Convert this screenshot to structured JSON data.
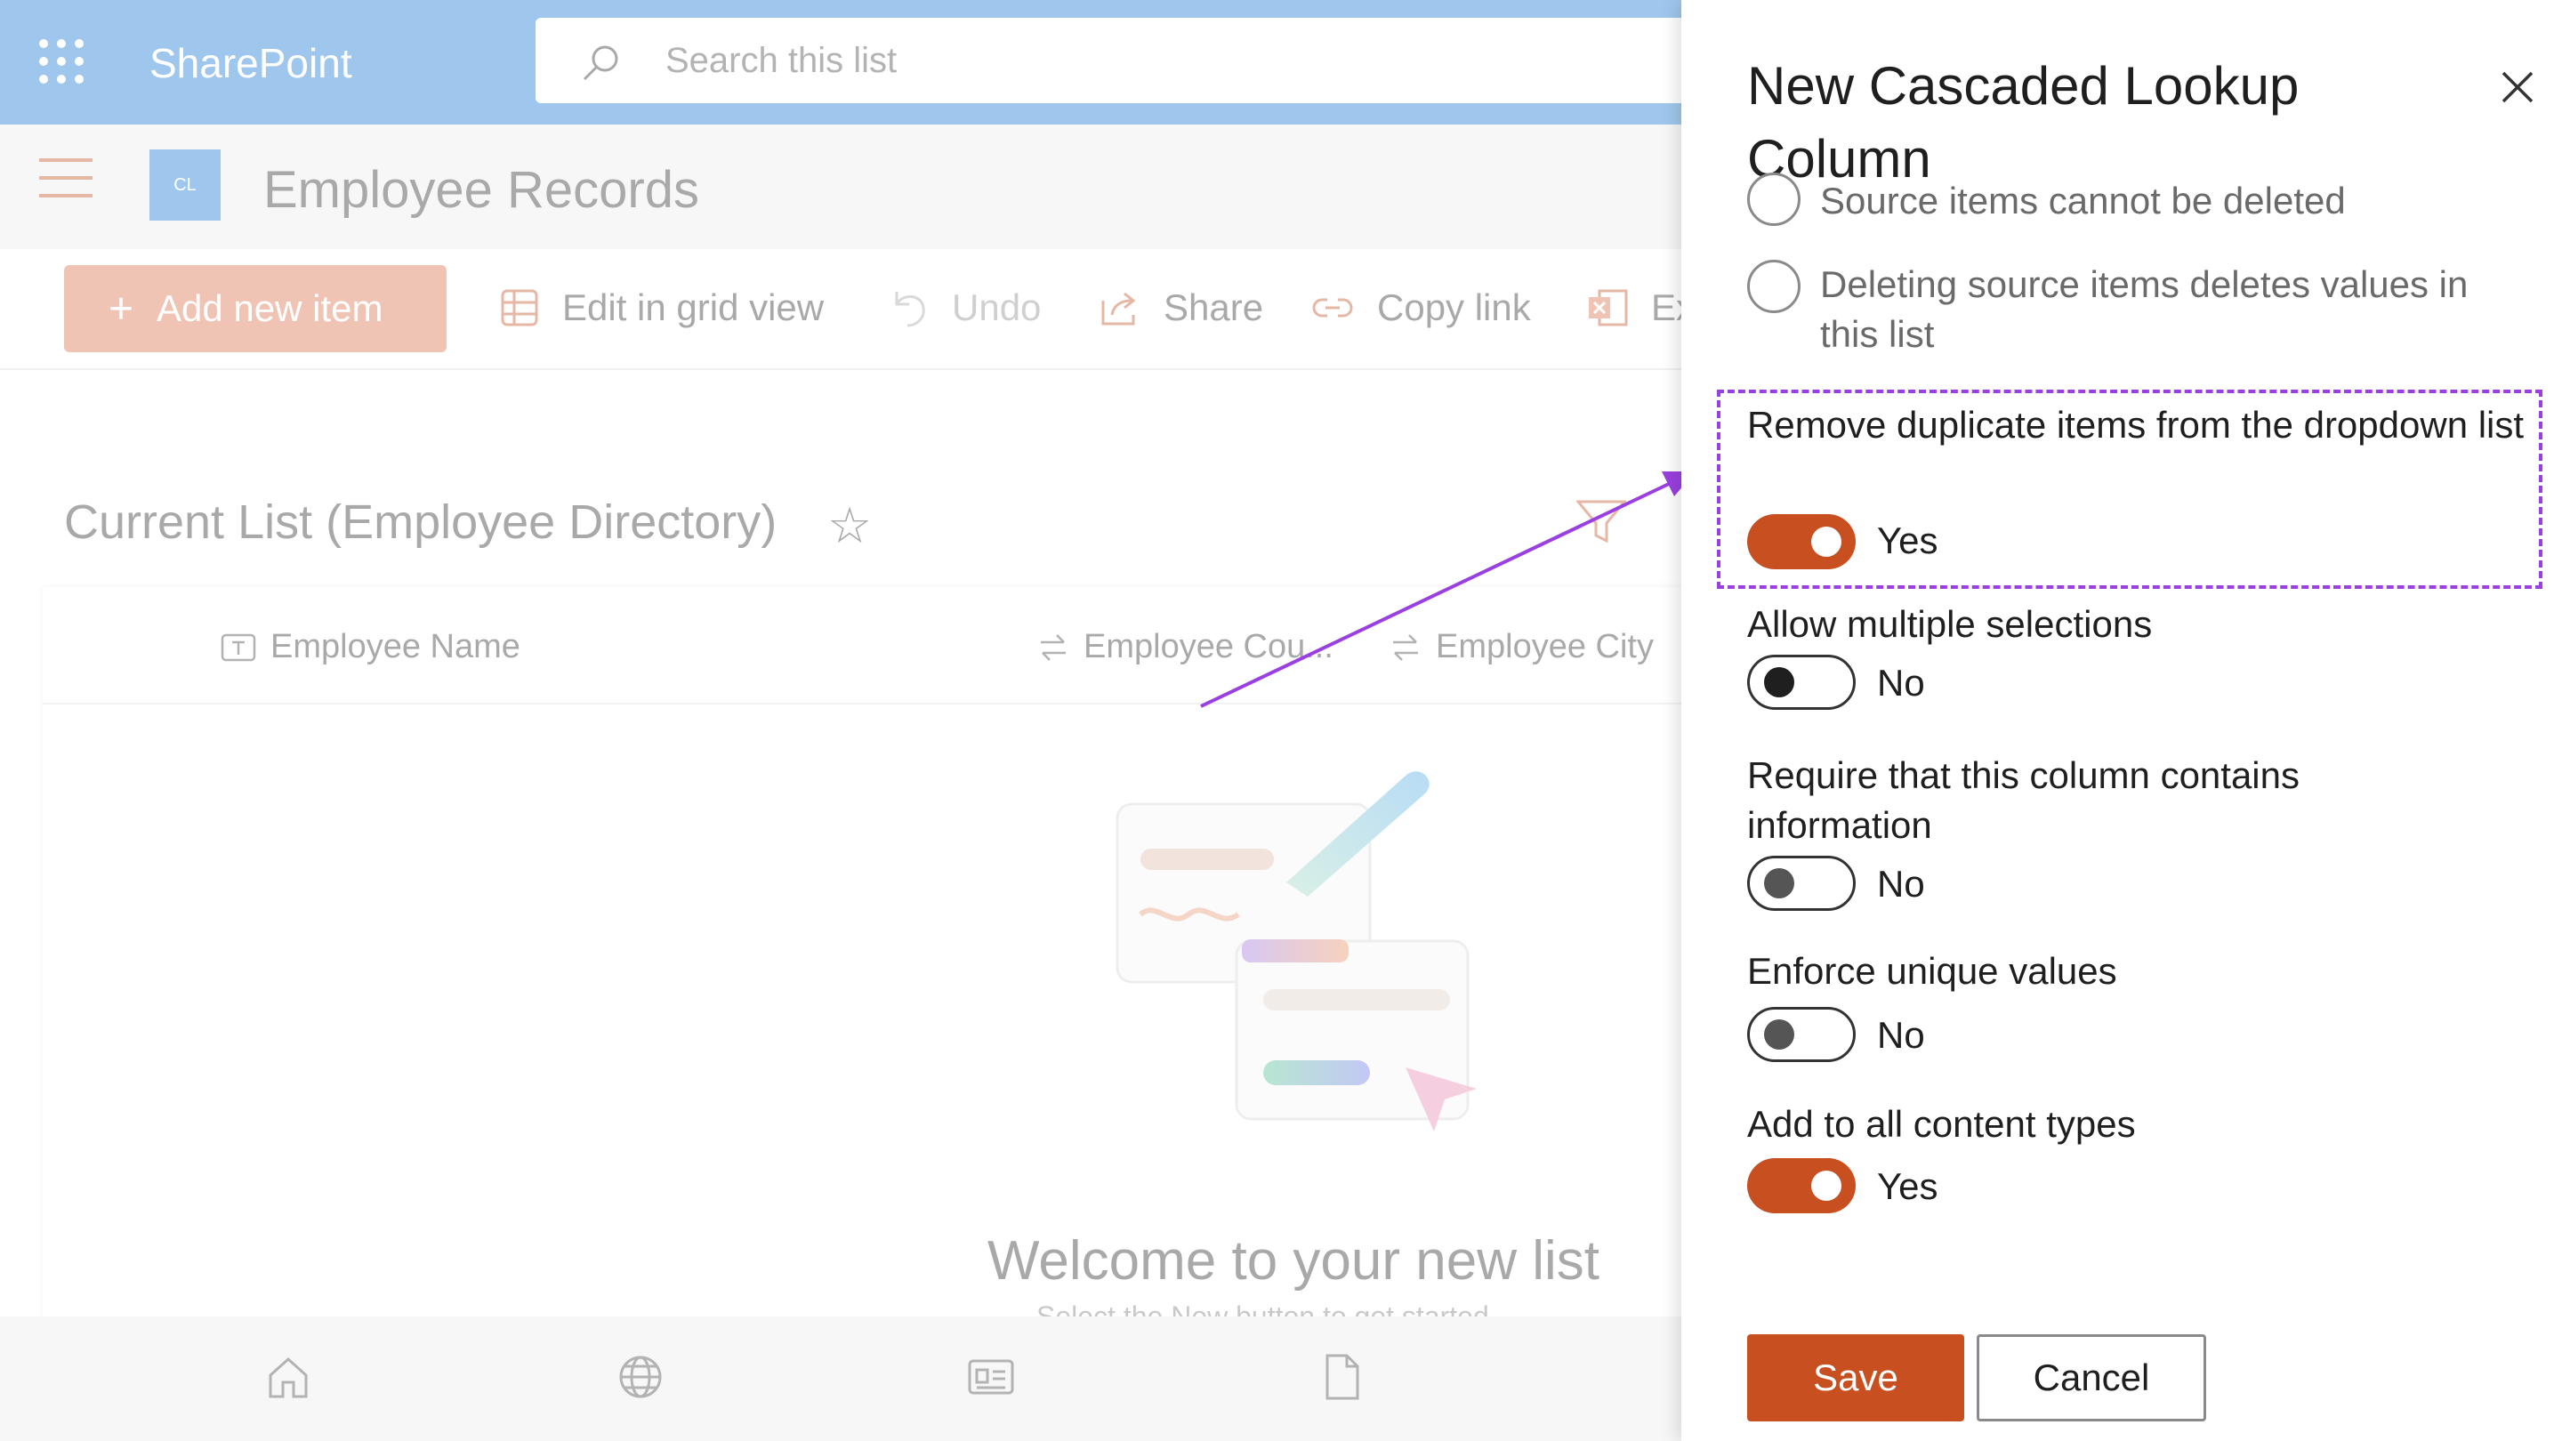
{
  "suitebar": {
    "app_name": "SharePoint",
    "search_placeholder": "Search this list",
    "waffle_icon": "waffle-icon"
  },
  "site": {
    "logo_text": "CL",
    "title": "Employee Records"
  },
  "commandbar": {
    "add_new_item": "Add new item",
    "edit_grid": "Edit in grid view",
    "undo": "Undo",
    "share": "Share",
    "copy_link": "Copy link",
    "export_partial": "Ex"
  },
  "list": {
    "title": "Current List (Employee Directory)",
    "columns": [
      "Employee Name",
      "Employee Cou...",
      "Employee City"
    ],
    "empty_title": "Welcome to your new list",
    "empty_subtitle": "Select the New button to get started."
  },
  "panel": {
    "title": "New Cascaded Lookup Column",
    "radio_options": [
      {
        "label": "Source items cannot be deleted",
        "selected": false
      },
      {
        "label": "Deleting source items deletes values in this list",
        "selected": false
      }
    ],
    "settings": [
      {
        "label": "Remove duplicate items from the dropdown list",
        "state": "Yes",
        "on": true,
        "highlighted": true
      },
      {
        "label": "Allow multiple selections",
        "state": "No",
        "on": false
      },
      {
        "label": "Require that this column contains information",
        "state": "No",
        "on": false
      },
      {
        "label": "Enforce unique values",
        "state": "No",
        "on": false
      },
      {
        "label": "Add to all content types",
        "state": "Yes",
        "on": true
      }
    ],
    "save_label": "Save",
    "cancel_label": "Cancel"
  },
  "colors": {
    "accent": "#c84f1f",
    "suitebar": "#9fc7ee",
    "highlight": "#9b40e0"
  }
}
